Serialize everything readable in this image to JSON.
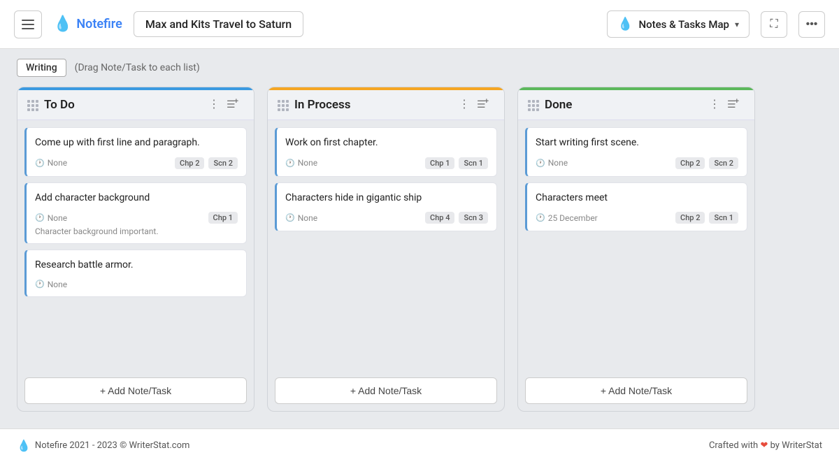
{
  "header": {
    "menu_label": "menu",
    "brand_name": "Notefire",
    "project_title": "Max and Kits Travel to Saturn",
    "view_label": "Notes & Tasks Map",
    "fullscreen_label": "fullscreen",
    "more_label": "more"
  },
  "subheader": {
    "badge": "Writing",
    "hint": "(Drag Note/Task to each list)"
  },
  "columns": [
    {
      "id": "todo",
      "title": "To Do",
      "color": "#3b9ae1",
      "cards": [
        {
          "title": "Come up with first line and paragraph.",
          "time": "None",
          "tags": [
            "Chp 2",
            "Scn 2"
          ],
          "note": ""
        },
        {
          "title": "Add character background",
          "time": "None",
          "tags": [
            "Chp 1"
          ],
          "note": "Character background important."
        },
        {
          "title": "Research battle armor.",
          "time": "None",
          "tags": [],
          "note": ""
        }
      ],
      "add_label": "+ Add Note/Task"
    },
    {
      "id": "in-process",
      "title": "In Process",
      "color": "#f5a623",
      "cards": [
        {
          "title": "Work on first chapter.",
          "time": "None",
          "tags": [
            "Chp 1",
            "Scn 1"
          ],
          "note": ""
        },
        {
          "title": "Characters hide in gigantic ship",
          "time": "None",
          "tags": [
            "Chp 4",
            "Scn 3"
          ],
          "note": ""
        }
      ],
      "add_label": "+ Add Note/Task"
    },
    {
      "id": "done",
      "title": "Done",
      "color": "#5cb85c",
      "cards": [
        {
          "title": "Start writing first scene.",
          "time": "None",
          "tags": [
            "Chp 2",
            "Scn 2"
          ],
          "note": ""
        },
        {
          "title": "Characters meet",
          "time": "25 December",
          "tags": [
            "Chp 2",
            "Scn 1"
          ],
          "note": ""
        }
      ],
      "add_label": "+ Add Note/Task"
    }
  ],
  "footer": {
    "brand_text": "Notefire 2021 - 2023 ©  WriterStat.com",
    "crafted_text": "Crafted with",
    "by_text": "by WriterStat"
  }
}
